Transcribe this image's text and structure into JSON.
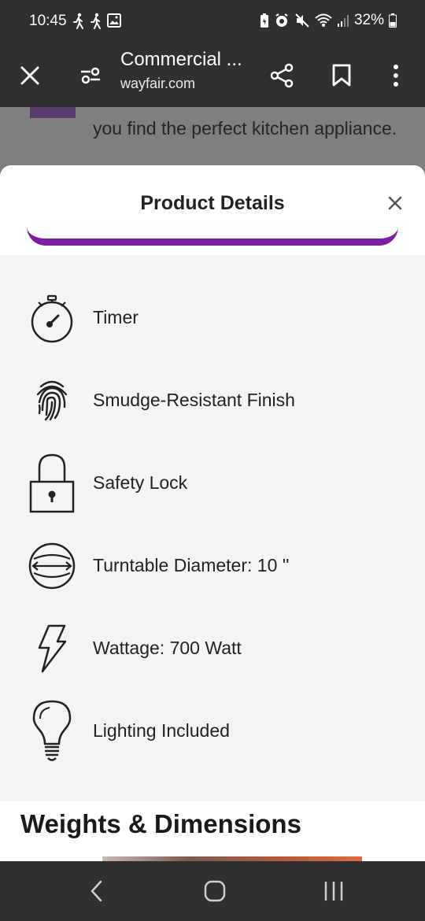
{
  "status_bar": {
    "time": "10:45",
    "battery": "32%",
    "left_icons": [
      "walking-icon",
      "walking-icon",
      "image-icon"
    ],
    "right_icons": [
      "battery-saver-icon",
      "alarm-icon",
      "mute-icon",
      "wifi-icon",
      "signal-icon",
      "battery-icon"
    ]
  },
  "toolbar": {
    "title": "Commercial ...",
    "url": "wayfair.com",
    "icons": [
      "close-icon",
      "site-settings-icon",
      "share-icon",
      "bookmark-icon",
      "more-icon"
    ]
  },
  "background_page": {
    "text": "you find the perfect kitchen appliance."
  },
  "sheet": {
    "title": "Product Details",
    "accent_color": "#7b1fa2",
    "features": [
      {
        "icon": "timer-icon",
        "label": "Timer"
      },
      {
        "icon": "fingerprint-icon",
        "label": "Smudge-Resistant Finish"
      },
      {
        "icon": "lock-icon",
        "label": "Safety Lock"
      },
      {
        "icon": "turntable-icon",
        "label": "Turntable Diameter: 10 ''"
      },
      {
        "icon": "lightning-icon",
        "label": "Wattage: 700 Watt"
      },
      {
        "icon": "lightbulb-icon",
        "label": "Lighting Included"
      }
    ]
  },
  "weights_dimensions": {
    "title": "Weights & Dimensions"
  },
  "nav_bar": {
    "buttons": [
      "back-icon",
      "home-icon",
      "recents-icon"
    ]
  }
}
